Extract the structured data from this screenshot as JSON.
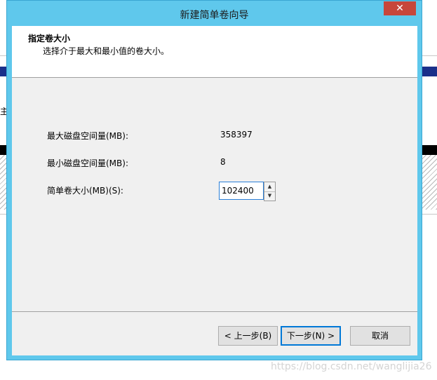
{
  "window": {
    "title": "新建简单卷向导",
    "close_glyph": "✕"
  },
  "header": {
    "title": "指定卷大小",
    "subtitle": "选择介于最大和最小值的卷大小。"
  },
  "fields": {
    "max_label": "最大磁盘空间量(MB):",
    "max_value": "358397",
    "min_label": "最小磁盘空间量(MB):",
    "min_value": "8",
    "size_label": "简单卷大小(MB)(S):",
    "size_value": "102400"
  },
  "buttons": {
    "back": "< 上一步(B)",
    "next": "下一步(N) >",
    "cancel": "取消"
  },
  "background": {
    "fragment_text": "主"
  },
  "watermark": "https://blog.csdn.net/wanglijia26"
}
